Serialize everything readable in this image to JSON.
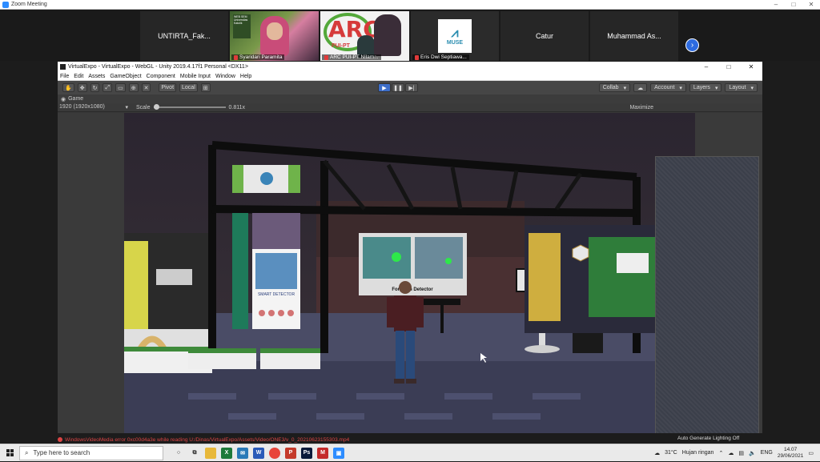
{
  "zoom": {
    "title": "Zoom Meeting"
  },
  "participants": [
    {
      "name": "UNTIRTA_Fak..."
    },
    {
      "name": "Syaridari Paramita"
    },
    {
      "name": "ARC PUI-PT Nilam..."
    },
    {
      "name": "Eris Dwi Septiawa..."
    },
    {
      "name": "Catur"
    },
    {
      "name": "Muhammad As..."
    }
  ],
  "zoom_tiles": {
    "video1_sign_line1": "WEB SEM",
    "video1_sign_line2": "Universitas Katolik",
    "arc_logo": "ARC",
    "arc_sub": "PUI-PT",
    "muse_logo": "MUSE"
  },
  "unity": {
    "window_title": "VirtualExpo - VirtualExpo - WebGL - Unity 2019.4.17f1 Personal <DX11>",
    "menu": [
      "File",
      "Edit",
      "Assets",
      "GameObject",
      "Component",
      "Mobile Input",
      "Window",
      "Help"
    ],
    "pivot_label": "Pivot",
    "local_label": "Local",
    "collab_label": "Collab",
    "account_label": "Account",
    "layers_label": "Layers",
    "layout_label": "Layout",
    "game_tab": "Game",
    "resolution": "1920 (1920x1080)",
    "scale_label": "Scale",
    "scale_value": "0.811x",
    "maximize_label": "Maximize",
    "error_text": "WindowsVideoMedia error 0xc00d4a3e while reading U:/Dinas/VirtualExpo/Assets/Video/ONE3/v_0_20210623155303.mp4",
    "lighting_status": "Auto Generate Lighting Off"
  },
  "scene": {
    "poster_text": "SMART DETECTOR",
    "screen_text": "Formalin Detector"
  },
  "taskbar": {
    "search_placeholder": "Type here to search",
    "weather_temp": "31°C",
    "weather_text": "Hujan ringan",
    "lang": "ENG",
    "time": "14.07",
    "date": "29/06/2021"
  }
}
